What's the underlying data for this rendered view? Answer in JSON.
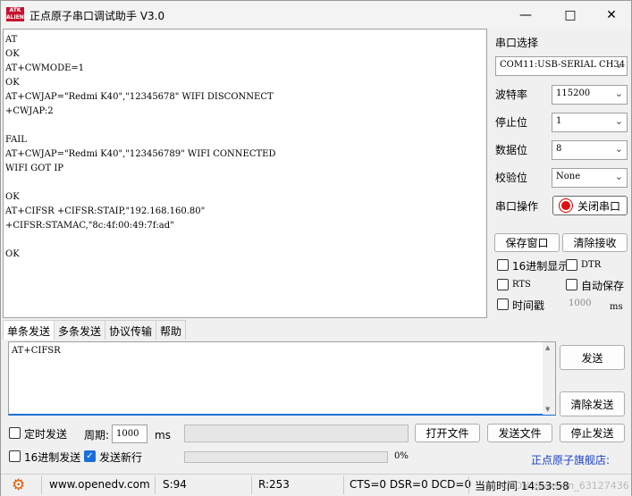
{
  "title_bar": {
    "logo_text": "ATK ALIENTEK",
    "title": "正点原子串口调试助手 V3.0"
  },
  "receive": {
    "lines": [
      "AT",
      "OK",
      "AT+CWMODE=1",
      "OK",
      "AT+CWJAP=\"Redmi K40\",\"12345678\" WIFI DISCONNECT",
      "+CWJAP:2",
      "",
      "FAIL",
      "AT+CWJAP=\"Redmi K40\",\"123456789\" WIFI CONNECTED",
      "WIFI GOT IP",
      "",
      "OK",
      "AT+CIFSR +CIFSR:STAIP,\"192.168.160.80\"",
      "+CIFSR:STAMAC,\"8c:4f:00:49:7f:ad\"",
      "",
      "OK"
    ]
  },
  "port_panel": {
    "port_select_label": "串口选择",
    "port_value": "COM11:USB-SERIAL CH34",
    "baud_label": "波特率",
    "baud_value": "115200",
    "stop_label": "停止位",
    "stop_value": "1",
    "data_label": "数据位",
    "data_value": "8",
    "parity_label": "校验位",
    "parity_value": "None",
    "op_label": "串口操作",
    "close_port_label": "关闭串口",
    "save_window_label": "保存窗口",
    "clear_recv_label": "清除接收",
    "hex_display_label": "16进制显示",
    "dtr_label": "DTR",
    "rts_label": "RTS",
    "auto_save_label": "自动保存",
    "timestamp_label": "时间戳",
    "timestamp_value": "1000",
    "timestamp_unit": "ms"
  },
  "tabs": [
    "单条发送",
    "多条发送",
    "协议传输",
    "帮助"
  ],
  "send": {
    "text": "AT+CIFSR",
    "send_label": "发送",
    "clear_send_label": "清除发送",
    "timed_send_label": "定时发送",
    "period_label": "周期:",
    "period_value": "1000",
    "period_unit": "ms",
    "open_file_label": "打开文件",
    "send_file_label": "发送文件",
    "stop_send_label": "停止发送",
    "hex_send_label": "16进制发送",
    "send_newline_label": "发送新行",
    "progress_text": "0%",
    "progress_fraction": 0,
    "store_link": "正点原子旗舰店:"
  },
  "status_bar": {
    "url": "www.openedv.com",
    "sent": "S:94",
    "recv": "R:253",
    "lines": "CTS=0 DSR=0 DCD=0",
    "time_label": "当前时间 14:53:58",
    "watermark": "CSDN @weixin_63127436"
  }
}
